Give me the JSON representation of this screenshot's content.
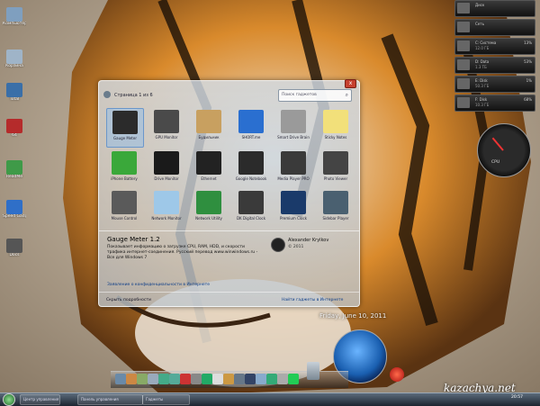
{
  "desktop": {
    "icons": [
      {
        "label": "Компьютер",
        "color": "#7f9fbf"
      },
      {
        "label": "Корзина",
        "color": "#9fb4c8"
      },
      {
        "label": "Total",
        "color": "#3a6fa8"
      },
      {
        "label": "64",
        "color": "#b52b2b"
      },
      {
        "label": "ReadMe",
        "color": "#3f9a48"
      },
      {
        "label": "Speed Gadget",
        "color": "#2f6fc8"
      },
      {
        "label": "Docs",
        "color": "#555555"
      }
    ]
  },
  "gadget_window": {
    "page_label": "Страница 1 из 6",
    "search_placeholder": "Поиск гаджетов",
    "close_label": "x",
    "tiles": [
      {
        "label": "Gauge Meter",
        "color": "#2b2b2b",
        "selected": true
      },
      {
        "label": "GPU Monitor",
        "color": "#4a4a4a"
      },
      {
        "label": "Будильник",
        "color": "#c8a060"
      },
      {
        "label": "SHORT.me",
        "color": "#2a6fd0"
      },
      {
        "label": "Smart Drive Brain",
        "color": "#9a9a9a"
      },
      {
        "label": "Sticky Notes",
        "color": "#f2e07a"
      },
      {
        "label": "iPhone Battery",
        "color": "#3aa83a"
      },
      {
        "label": "Drive Monitor",
        "color": "#1a1a1a"
      },
      {
        "label": "Ethernet",
        "color": "#222222"
      },
      {
        "label": "Google Notebook",
        "color": "#2b2b2b"
      },
      {
        "label": "Media Player PRO",
        "color": "#3a3a3a"
      },
      {
        "label": "Photo Viewer",
        "color": "#444444"
      },
      {
        "label": "Mouse Control",
        "color": "#5a5a5a"
      },
      {
        "label": "Network Monitor",
        "color": "#9ec8e8"
      },
      {
        "label": "Network Utility",
        "color": "#2f8f3f"
      },
      {
        "label": "DK Digital Clock",
        "color": "#3a3a3a"
      },
      {
        "label": "Premium Clock",
        "color": "#1a3a6a"
      },
      {
        "label": "Sidebar Player",
        "color": "#4a6070"
      }
    ],
    "details": {
      "name": "Gauge Meter 1.2",
      "description": "Показывает информацию о загрузке CPU, RAM, HDD, и скорости трафика интернет-соединения. Русский перевод www.winwindows.ru - Все для Windows 7",
      "author": "Alexander Krylkov",
      "version": "© 2011"
    },
    "link": "Заявление о конфиденциальности в Интернете",
    "hide_details": "Скрыть подробности",
    "more_online": "Найти гаджеты в Интернете"
  },
  "side_gadgets": [
    {
      "title": "Диск",
      "sub": "",
      "value": ""
    },
    {
      "title": "Сеть",
      "sub": "",
      "value": ""
    },
    {
      "title": "C: Система",
      "sub": "12.0 ГБ",
      "value": "13%"
    },
    {
      "title": "D: Data",
      "sub": "1.3 ТБ",
      "value": "53%"
    },
    {
      "title": "E: Disk",
      "sub": "50.3 ГБ",
      "value": "1%"
    },
    {
      "title": "F: Disk",
      "sub": "10.3 ГБ",
      "value": "68%"
    },
    {
      "title": "G: Disk",
      "sub": "22.6 ГБ",
      "value": "43%"
    }
  ],
  "cpu_gauge": {
    "label": "CPU"
  },
  "date_text": "Friday, June 10, 2011",
  "watermark": "kazachya.net",
  "taskbar": {
    "items": [
      "Центр управления",
      "Панель управления",
      "Гаджеты"
    ],
    "time": "20:57"
  }
}
